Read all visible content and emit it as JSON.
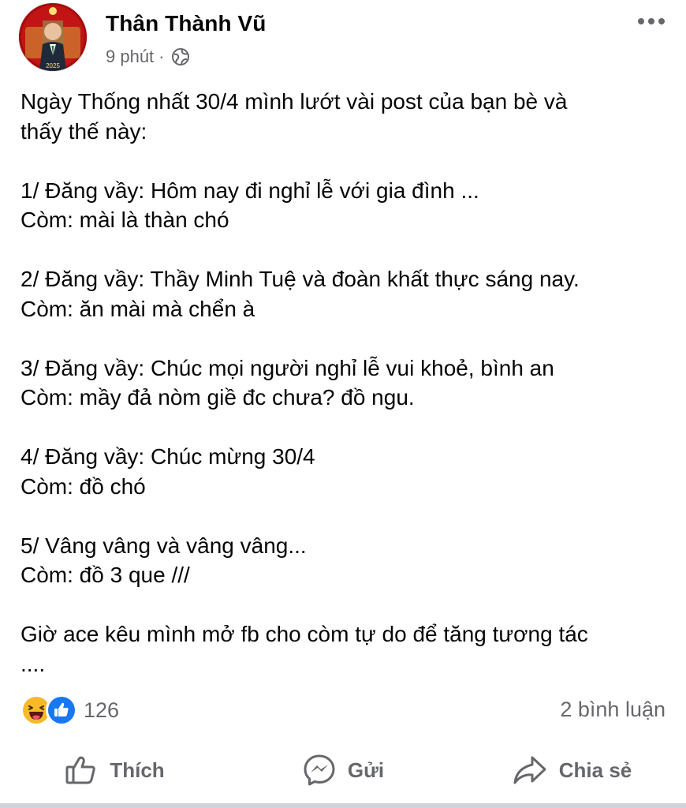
{
  "post": {
    "author": "Thân Thành Vũ",
    "time": "9 phút",
    "separator": "·",
    "privacy_icon": "globe-icon",
    "avatar_badge_text": "2025",
    "body": {
      "intro": "Ngày Thống nhất 30/4 mình lướt vài post của bạn bè và\nthấy thế này:",
      "items": [
        {
          "post": "1/ Đăng vầy: Hôm nay đi nghỉ lễ với gia đình ...",
          "comment": "Còm: mài là thàn chó"
        },
        {
          "post": "2/ Đăng vầy: Thầy Minh Tuệ và đoàn khất thực sáng nay.",
          "comment": "Còm: ăn mài mà chển à"
        },
        {
          "post": "3/ Đăng vầy: Chúc mọi người nghỉ lễ vui khoẻ, bình an",
          "comment": "Còm: mầy đả nòm giề đc chưa? đồ ngu."
        },
        {
          "post": "4/ Đăng vầy: Chúc mừng 30/4",
          "comment": "Còm: đồ chó"
        },
        {
          "post": "5/ Vâng vâng và vâng vâng...",
          "comment": "Còm: đồ 3 que ///"
        }
      ],
      "outro": "Giờ ace kêu mình mở fb cho còm tự do để tăng tương tác\n...."
    },
    "reactions": {
      "icons": [
        "haha-icon",
        "like-icon"
      ],
      "count": "126"
    },
    "comments_label": "2 bình luận",
    "actions": {
      "like": "Thích",
      "send": "Gửi",
      "share": "Chia sẻ"
    }
  },
  "colors": {
    "text": "#050505",
    "secondary": "#65676b",
    "like_blue": "#1877f2",
    "haha_yellow": "#f7b928"
  }
}
